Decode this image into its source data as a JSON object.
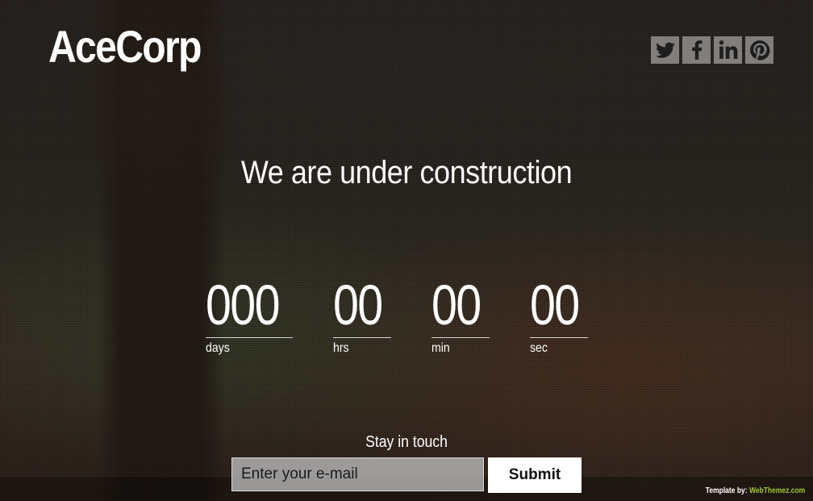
{
  "brand": {
    "logo_text": "AceCorp"
  },
  "social": [
    {
      "name": "twitter",
      "icon": "twitter-icon"
    },
    {
      "name": "facebook",
      "icon": "facebook-icon"
    },
    {
      "name": "linkedin",
      "icon": "linkedin-icon"
    },
    {
      "name": "pinterest",
      "icon": "pinterest-icon"
    }
  ],
  "headline": "We are under construction",
  "countdown": {
    "days": {
      "value": "000",
      "label": "days"
    },
    "hours": {
      "value": "00",
      "label": "hrs"
    },
    "minutes": {
      "value": "00",
      "label": "min"
    },
    "seconds": {
      "value": "00",
      "label": "sec"
    }
  },
  "subscribe": {
    "heading": "Stay in touch",
    "email_placeholder": "Enter your e-mail",
    "email_value": "",
    "submit_label": "Submit"
  },
  "footer": {
    "credit_prefix": "Template by:",
    "credit_link": "WebThemez.com"
  },
  "colors": {
    "text": "#ffffff",
    "credit_link": "#9ecb2e",
    "social_tile": "#a0a0a0"
  }
}
